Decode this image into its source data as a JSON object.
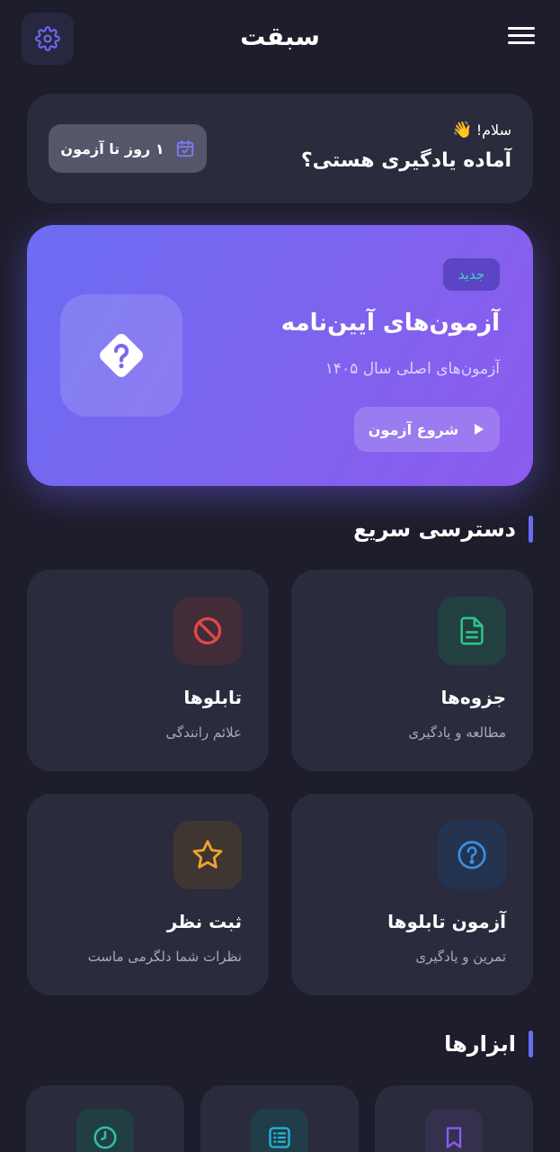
{
  "header": {
    "title": "سبقت",
    "menu_icon": "hamburger-menu-icon",
    "settings_icon": "gear-icon"
  },
  "greeting": {
    "hello": "سلام!",
    "question": "آماده یادگیری هستی؟",
    "exam_countdown": "۱ روز تا آزمون"
  },
  "hero": {
    "badge": "جدید",
    "title": "آزمون‌های آیین‌نامه",
    "subtitle": "آزمون‌های اصلی سال ۱۴۰۵",
    "start_label": "شروع آزمون"
  },
  "quick_access": {
    "title": "دسترسی سریع",
    "items": [
      {
        "title": "جزوه‌ها",
        "subtitle": "مطالعه و یادگیری",
        "icon": "document-icon",
        "color": "#2ec28b"
      },
      {
        "title": "تابلوها",
        "subtitle": "علائم رانندگی",
        "icon": "prohibited-icon",
        "color": "#e0474c"
      },
      {
        "title": "آزمون تابلوها",
        "subtitle": "تمرین و یادگیری",
        "icon": "question-circle-icon",
        "color": "#3b8fe0"
      },
      {
        "title": "ثبت نظر",
        "subtitle": "نظرات شما دلگرمی ماست",
        "icon": "star-icon",
        "color": "#f0a22e"
      }
    ]
  },
  "tools": {
    "title": "ابزارها",
    "items": [
      {
        "icon": "bookmark-icon",
        "color": "#8b5cf6"
      },
      {
        "icon": "list-icon",
        "color": "#1fb6d4"
      },
      {
        "icon": "clock-icon",
        "color": "#2ec2a8"
      }
    ]
  },
  "colors": {
    "background": "#1d1d2b",
    "card": "#2a2b3c",
    "accent": "#6a6cf5"
  }
}
